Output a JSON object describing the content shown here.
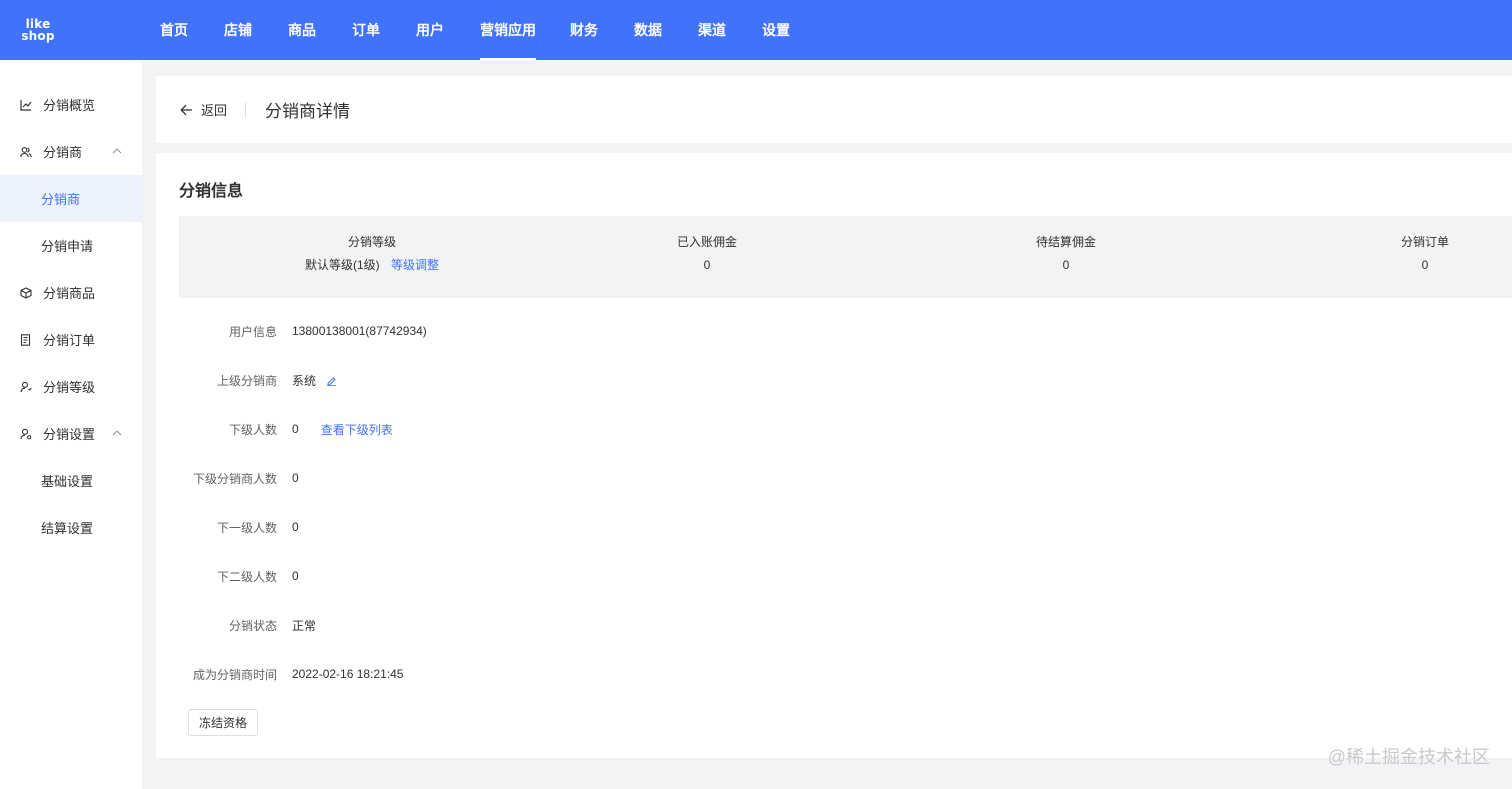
{
  "logo": {
    "line1": "like",
    "line2": "shop"
  },
  "nav": [
    "首页",
    "店铺",
    "商品",
    "订单",
    "用户",
    "营销应用",
    "财务",
    "数据",
    "渠道",
    "设置"
  ],
  "nav_active": "营销应用",
  "sidebar": {
    "overview": "分销概览",
    "distributor_group": "分销商",
    "distributor": "分销商",
    "apply": "分销申请",
    "goods": "分销商品",
    "orders": "分销订单",
    "level": "分销等级",
    "settings_group": "分销设置",
    "basic": "基础设置",
    "settle": "结算设置"
  },
  "header": {
    "back": "返回",
    "title": "分销商详情"
  },
  "info": {
    "section_title": "分销信息",
    "stats": {
      "level_label": "分销等级",
      "level_value": "默认等级(1级)",
      "level_adjust": "等级调整",
      "settled_label": "已入账佣金",
      "settled_value": "0",
      "pending_label": "待结算佣金",
      "pending_value": "0",
      "orders_label": "分销订单",
      "orders_value": "0"
    },
    "rows": {
      "user_label": "用户信息",
      "user_value": "13800138001(87742934)",
      "parent_label": "上级分销商",
      "parent_value": "系统",
      "sub_label": "下级人数",
      "sub_value": "0",
      "sub_link": "查看下级列表",
      "sub_dist_label": "下级分销商人数",
      "sub_dist_value": "0",
      "first_label": "下一级人数",
      "first_value": "0",
      "second_label": "下二级人数",
      "second_value": "0",
      "status_label": "分销状态",
      "status_value": "正常",
      "time_label": "成为分销商时间",
      "time_value": "2022-02-16 18:21:45"
    },
    "freeze_button": "冻结资格"
  },
  "watermark": "@稀土掘金技术社区",
  "colors": {
    "primary": "#4073fa",
    "active_bg": "#ecf2fe"
  }
}
